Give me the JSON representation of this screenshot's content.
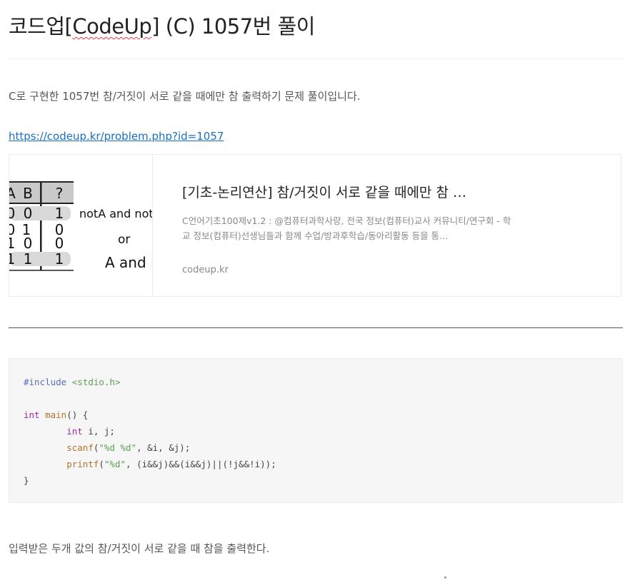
{
  "post": {
    "title_prefix": "코드업[",
    "title_highlight": "CodeUp",
    "title_suffix": "] (C) 1057번 풀이",
    "intro": "C로 구현한 1057번 참/거짓이 서로 같을 때에만 참 출력하기 문제 풀이입니다.",
    "link": "https://codeup.kr/problem.php?id=1057",
    "outro": "입력받은 두개 값의 참/거짓이 서로 같을 때 참을 출력한다."
  },
  "card": {
    "title": "[기초-논리연산] 참/거짓이 서로 같을 때에만 참 …",
    "description": "C언어기초100제v1.2 : @컴퓨터과학사랑, 전국 정보(컴퓨터)교사 커뮤니티/연구회 - 학교 정보(컴퓨터)선생님들과 함께 수업/방과후학습/동아리활동 등을 통…",
    "domain": "codeup.kr",
    "thumbnail": {
      "col_a": "A",
      "col_b": "B",
      "col_result": "?",
      "rows": [
        {
          "a": "0",
          "b": "0",
          "r": "1"
        },
        {
          "a": "0",
          "b": "1",
          "r": "0"
        },
        {
          "a": "1",
          "b": "0",
          "r": "0"
        },
        {
          "a": "1",
          "b": "1",
          "r": "1"
        }
      ],
      "note_line1": "notA and not",
      "note_line2": "or",
      "note_line3": "A and B"
    }
  },
  "code": {
    "include_directive": "#include",
    "include_header": "<stdio.h>",
    "kw_int": "int",
    "main_name": "main",
    "main_rest": "() {",
    "decl_rest": " i, j;",
    "scanf_name": "scanf",
    "scanf_open": "(",
    "scanf_fmt": "\"%d %d\"",
    "scanf_rest": ", &i, &j);",
    "printf_name": "printf",
    "printf_open": "(",
    "printf_fmt": "\"%d\"",
    "printf_rest": ", (i&&j)&&(i&&j)||(!j&&!i));",
    "close_brace": "}"
  }
}
